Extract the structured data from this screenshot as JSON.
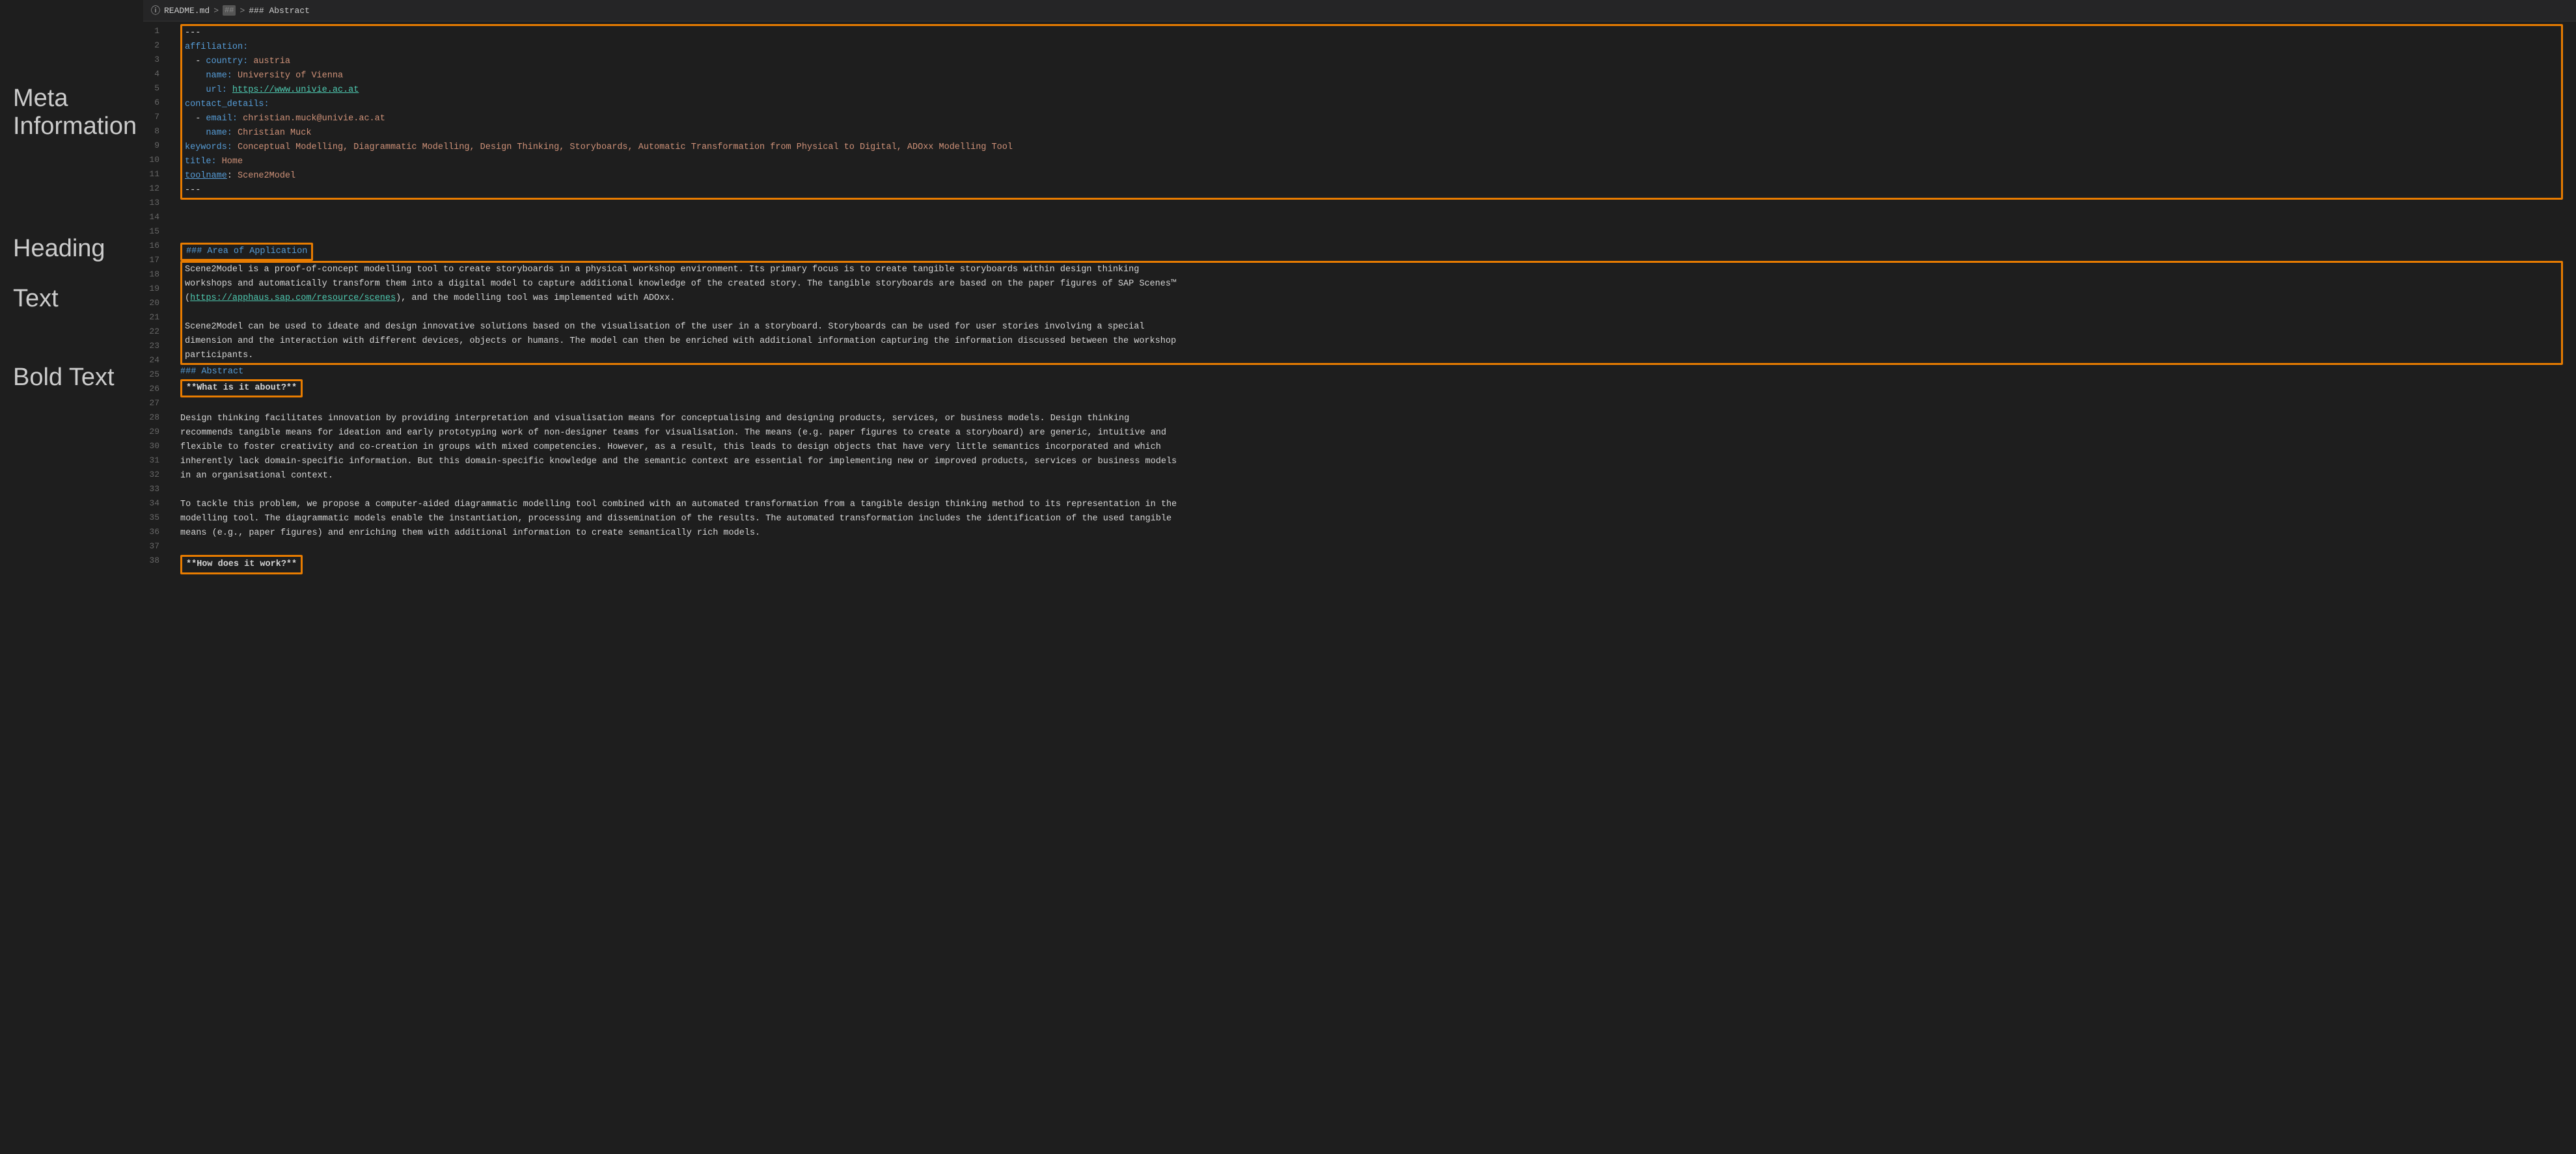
{
  "breadcrumb": {
    "info_icon": "ⓘ",
    "filename": "README.md",
    "separator1": ">",
    "md_icon": "##",
    "separator2": ">",
    "section": "### Abstract"
  },
  "annotations": {
    "meta": "Meta Information",
    "heading": "Heading",
    "text": "Text",
    "bold": "Bold Text"
  },
  "lines": [
    {
      "num": 1,
      "content": "---",
      "type": "separator"
    },
    {
      "num": 2,
      "content": "affiliation:",
      "type": "key"
    },
    {
      "num": 3,
      "content": "  - country: austria",
      "type": "key-val"
    },
    {
      "num": 4,
      "content": "    name: University of Vienna",
      "type": "key-val"
    },
    {
      "num": 5,
      "content": "    url: https://www.univie.ac.at",
      "type": "key-url"
    },
    {
      "num": 6,
      "content": "contact_details:",
      "type": "key"
    },
    {
      "num": 7,
      "content": "  - email: christian.muck@univie.ac.at",
      "type": "key-val"
    },
    {
      "num": 8,
      "content": "    name: Christian Muck",
      "type": "key-val"
    },
    {
      "num": 9,
      "content": "keywords: Conceptual Modelling, Diagrammatic Modelling, Design Thinking, Storyboards, Automatic Transformation from Physical to Digital, ADOxx Modelling Tool",
      "type": "key-val-long"
    },
    {
      "num": 10,
      "content": "title: Home",
      "type": "key-val"
    },
    {
      "num": 11,
      "content": "toolname: Scene2Model",
      "type": "key-url-underline"
    },
    {
      "num": 12,
      "content": "---",
      "type": "separator"
    },
    {
      "num": 13,
      "content": "",
      "type": "empty"
    },
    {
      "num": 14,
      "content": "",
      "type": "empty"
    },
    {
      "num": 15,
      "content": "",
      "type": "empty"
    },
    {
      "num": 16,
      "content": "### Area of Application",
      "type": "heading"
    },
    {
      "num": 17,
      "content": "Scene2Model is a proof-of-concept modelling tool to create storyboards in a physical workshop environment. Its primary focus is to create tangible storyboards within design thinking",
      "type": "text"
    },
    {
      "num": 18,
      "content": "workshops and automatically transform them into a digital model to capture additional knowledge of the created story. The tangible storyboards are based on the paper figures of SAP Scenes™",
      "type": "text"
    },
    {
      "num": 19,
      "content": "(https://apphaus.sap.com/resource/scenes), and the modelling tool was implemented with ADOxx.",
      "type": "text-link"
    },
    {
      "num": 20,
      "content": "",
      "type": "empty"
    },
    {
      "num": 21,
      "content": "Scene2Model can be used to ideate and design innovative solutions based on the visualisation of the user in a storyboard. Storyboards can be used for user stories involving a special",
      "type": "text"
    },
    {
      "num": 22,
      "content": "dimension and the interaction with different devices, objects or humans. The model can then be enriched with additional information capturing the information discussed between the workshop",
      "type": "text"
    },
    {
      "num": 23,
      "content": "participants.",
      "type": "text"
    },
    {
      "num": 24,
      "content": "### Abstract",
      "type": "heading2"
    },
    {
      "num": 25,
      "content": "**What is it about?**",
      "type": "bold-heading"
    },
    {
      "num": 26,
      "content": "",
      "type": "empty"
    },
    {
      "num": 27,
      "content": "Design thinking facilitates innovation by providing interpretation and visualisation means for conceptualising and designing products, services, or business models. Design thinking",
      "type": "text"
    },
    {
      "num": 28,
      "content": "recommends tangible means for ideation and early prototyping work of non-designer teams for visualisation. The means (e.g. paper figures to create a storyboard) are generic, intuitive and",
      "type": "text"
    },
    {
      "num": 29,
      "content": "flexible to foster creativity and co-creation in groups with mixed competencies. However, as a result, this leads to design objects that have very little semantics incorporated and which",
      "type": "text"
    },
    {
      "num": 30,
      "content": "inherently lack domain-specific information. But this domain-specific knowledge and the semantic context are essential for implementing new or improved products, services or business models",
      "type": "text"
    },
    {
      "num": 31,
      "content": "in an organisational context.",
      "type": "text"
    },
    {
      "num": 32,
      "content": "",
      "type": "empty"
    },
    {
      "num": 33,
      "content": "To tackle this problem, we propose a computer-aided diagrammatic modelling tool combined with an automated transformation from a tangible design thinking method to its representation in the",
      "type": "text"
    },
    {
      "num": 34,
      "content": "modelling tool. The diagrammatic models enable the instantiation, processing and dissemination of the results. The automated transformation includes the identification of the used tangible",
      "type": "text"
    },
    {
      "num": 35,
      "content": "means (e.g., paper figures) and enriching them with additional information to create semantically rich models.",
      "type": "text"
    },
    {
      "num": 36,
      "content": "",
      "type": "empty"
    },
    {
      "num": 37,
      "content": "**How does it work?**",
      "type": "bold-heading"
    },
    {
      "num": 38,
      "content": "",
      "type": "empty"
    }
  ],
  "colors": {
    "orange_border": "#e87c00",
    "bg_dark": "#1e1e1e",
    "bg_bar": "#252526",
    "text_normal": "#d4d4d4",
    "text_key": "#569cd6",
    "text_value": "#ce9178",
    "text_url": "#4ec9b0",
    "text_line_num": "#666666"
  }
}
